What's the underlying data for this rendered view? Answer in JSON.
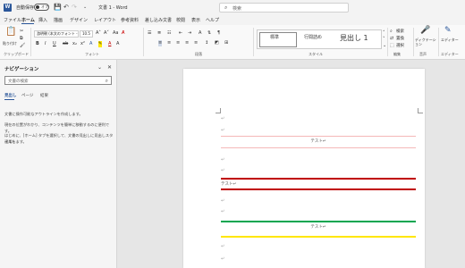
{
  "titlebar": {
    "app_icon": "word-icon",
    "app_letter": "W",
    "autosave_label": "自動保存",
    "autosave_state": "オフ",
    "doc_title": "文書 1  -  Word",
    "search_placeholder": "検索",
    "icons": [
      "save-icon",
      "undo-icon",
      "redo-icon",
      "customize-icon"
    ]
  },
  "menu": {
    "items": [
      "ファイル",
      "ホーム",
      "挿入",
      "描画",
      "デザイン",
      "レイアウト",
      "参考資料",
      "差し込み文書",
      "校閲",
      "表示",
      "ヘルプ"
    ],
    "active_index": 1
  },
  "ribbon": {
    "clipboard": {
      "paste_label": "貼り付け",
      "group": "クリップボード"
    },
    "font": {
      "name": "游明朝 (本文のフォント - 日本語)",
      "size": "10.5",
      "group": "フォント"
    },
    "paragraph": {
      "group": "段落"
    },
    "styles": {
      "items": [
        "標準",
        "行間詰め",
        "見出し 1"
      ],
      "group": "スタイル"
    },
    "editing": {
      "items": [
        "検索",
        "置換",
        "選択"
      ],
      "group": "編集"
    },
    "voice": {
      "label": "ディクテーション",
      "group": "音声"
    },
    "editor": {
      "label": "エディター",
      "group": "エディター"
    }
  },
  "navpane": {
    "title": "ナビゲーション",
    "search_placeholder": "文書の検索",
    "tabs": [
      "見出し",
      "ページ",
      "結果"
    ],
    "active_tab": 0,
    "text_lines": [
      "文書に操作可能なアウトラインを作成します。",
      "現在の位置がわかり、コンテンツを簡単に移動するのに便利です。",
      "はじめに、[ホーム] タブを選択して、文書の見出しに見出しスタイルを",
      "適用します。"
    ]
  },
  "document": {
    "paragraph_mark": "↵",
    "test_label": "テスト↵",
    "colors": {
      "pink": "#f4b8b8",
      "red": "#c00000",
      "green": "#00a650",
      "yellow": "#ffe600"
    }
  }
}
